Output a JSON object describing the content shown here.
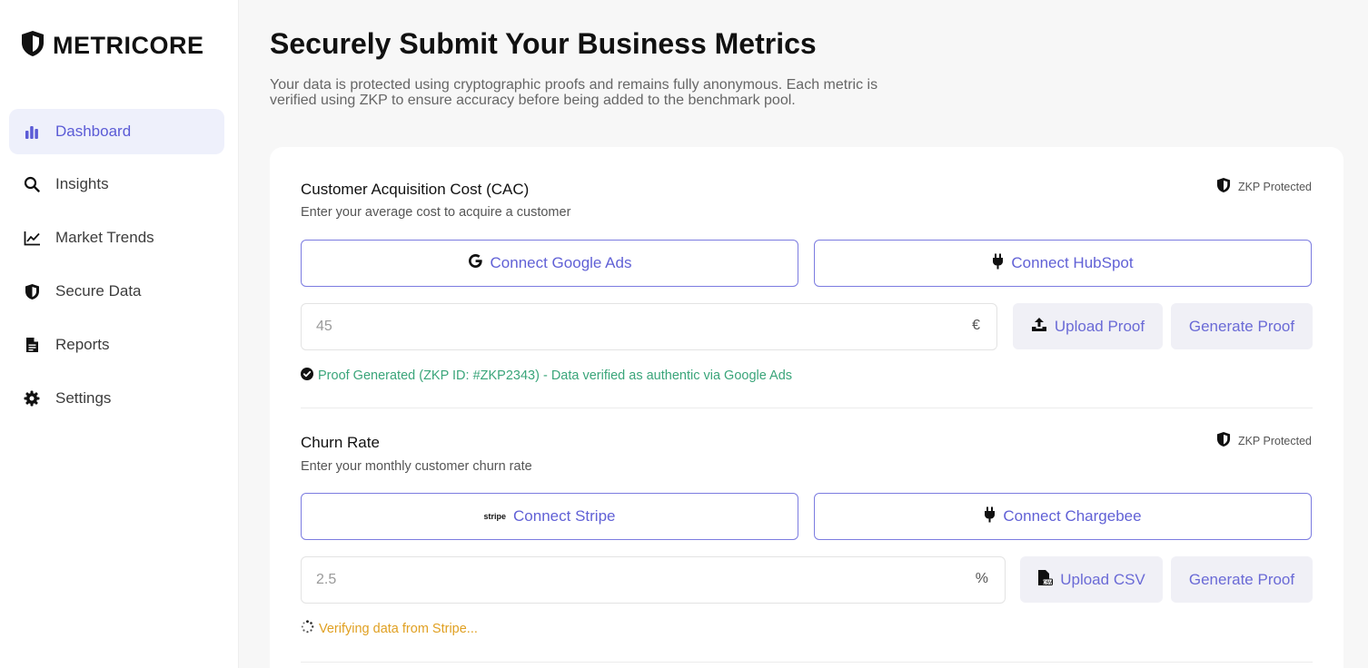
{
  "brand": {
    "name": "METRICORE",
    "icon": "shield-icon"
  },
  "sidebar": {
    "items": [
      {
        "label": "Dashboard",
        "icon": "bar-chart-icon",
        "active": true
      },
      {
        "label": "Insights",
        "icon": "search-icon"
      },
      {
        "label": "Market Trends",
        "icon": "line-chart-icon"
      },
      {
        "label": "Secure Data",
        "icon": "shield-icon"
      },
      {
        "label": "Reports",
        "icon": "document-icon"
      },
      {
        "label": "Settings",
        "icon": "gear-icon"
      }
    ]
  },
  "header": {
    "title": "Securely Submit Your Business Metrics",
    "description_line1": "Your data is protected using cryptographic proofs and remains fully anonymous. Each metric is",
    "description_line2": "verified using ZKP to ensure accuracy before being added to the benchmark pool."
  },
  "metrics": [
    {
      "title": "Customer Acquisition Cost (CAC)",
      "subtitle": "Enter your average cost to acquire a customer",
      "badge": "ZKP Protected",
      "connect_primary": {
        "label": "Connect Google Ads",
        "icon": "google-icon"
      },
      "connect_secondary": {
        "label": "Connect HubSpot",
        "icon": "plug-icon"
      },
      "placeholder": "45",
      "unit": "€",
      "upload_label": "Upload Proof",
      "upload_icon": "upload-icon",
      "generate_label": "Generate Proof",
      "status": "Proof Generated (ZKP ID: #ZKP2343) - Data verified as authentic via Google Ads",
      "status_state": "verified"
    },
    {
      "title": "Churn Rate",
      "subtitle": "Enter your monthly customer churn rate",
      "badge": "ZKP Protected",
      "connect_primary": {
        "label": "Connect Stripe",
        "icon": "stripe-icon",
        "icon_text": "stripe"
      },
      "connect_secondary": {
        "label": "Connect Chargebee",
        "icon": "plug-icon"
      },
      "placeholder": "2.5",
      "unit": "%",
      "upload_label": "Upload CSV",
      "upload_icon": "csv-file-icon",
      "generate_label": "Generate Proof",
      "status": "Verifying data from Stripe...",
      "status_state": "pending"
    }
  ],
  "colors": {
    "accent": "#6161d6",
    "active_bg": "#eef0fb",
    "verified": "#3aa57a",
    "pending": "#e0a022"
  }
}
